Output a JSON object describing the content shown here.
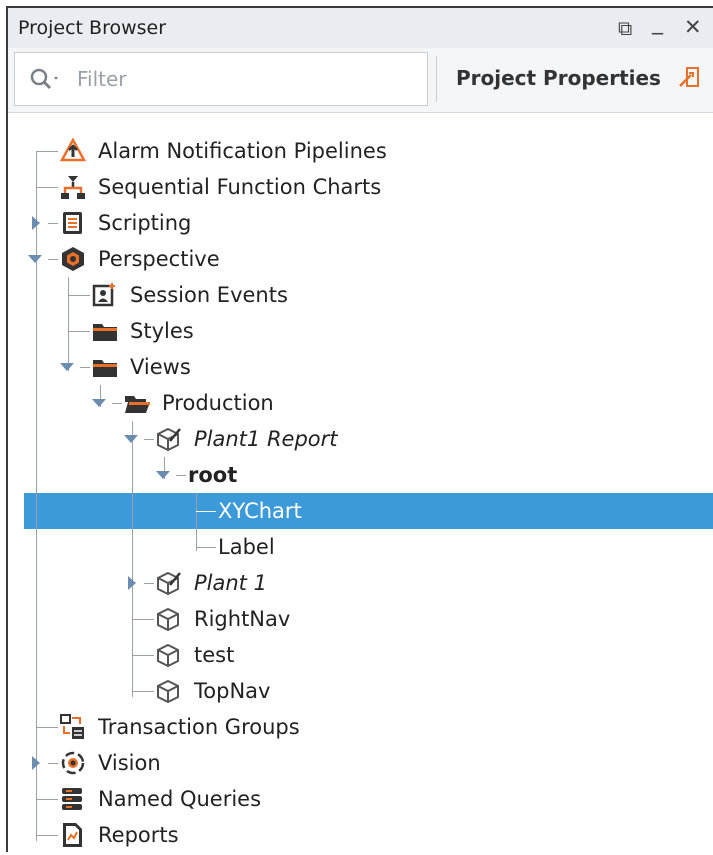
{
  "panel": {
    "title": "Project Browser",
    "restore_glyph": "⧉",
    "minimize_glyph": "_",
    "close_glyph": "✕"
  },
  "toolbar": {
    "filter_placeholder": "Filter",
    "project_properties_label": "Project Properties"
  },
  "tree": {
    "items": [
      {
        "label": "Alarm Notification Pipelines",
        "icon": "alarm-pipeline-icon"
      },
      {
        "label": "Sequential Function Charts",
        "icon": "sfc-icon"
      },
      {
        "label": "Scripting",
        "icon": "scripting-icon"
      },
      {
        "label": "Perspective",
        "icon": "perspective-icon"
      },
      {
        "label": "Session Events",
        "icon": "session-events-icon"
      },
      {
        "label": "Styles",
        "icon": "folder-icon"
      },
      {
        "label": "Views",
        "icon": "folder-icon"
      },
      {
        "label": "Production",
        "icon": "folder-open-icon"
      },
      {
        "label": "Plant1 Report",
        "icon": "view-edited-icon"
      },
      {
        "label": "root",
        "icon": ""
      },
      {
        "label": "XYChart",
        "icon": ""
      },
      {
        "label": "Label",
        "icon": ""
      },
      {
        "label": "Plant 1",
        "icon": "view-edited-icon"
      },
      {
        "label": "RightNav",
        "icon": "view-icon"
      },
      {
        "label": "test",
        "icon": "view-icon"
      },
      {
        "label": "TopNav",
        "icon": "view-icon"
      },
      {
        "label": "Transaction Groups",
        "icon": "transaction-groups-icon"
      },
      {
        "label": "Vision",
        "icon": "vision-icon"
      },
      {
        "label": "Named Queries",
        "icon": "named-queries-icon"
      },
      {
        "label": "Reports",
        "icon": "reports-icon"
      }
    ],
    "selected": "XYChart"
  },
  "colors": {
    "selection": "#3d9ad8",
    "accent_orange": "#e8702a"
  }
}
